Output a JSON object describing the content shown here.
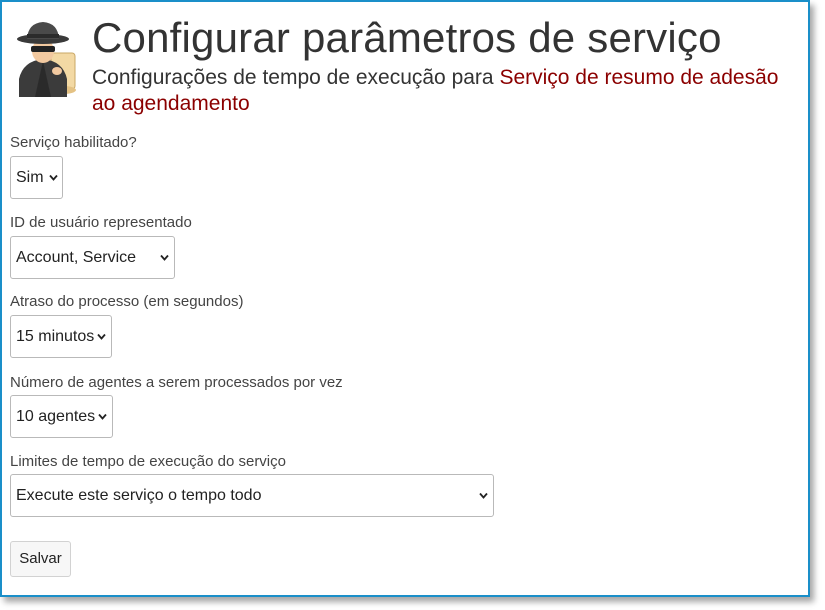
{
  "header": {
    "title": "Configurar parâmetros de serviço",
    "subtitle_prefix": "Configurações de tempo de execução para ",
    "service_name": "Serviço de resumo de adesão ao agendamento",
    "service_color": "#8b0000",
    "logo_icon": "spy-agent-icon"
  },
  "fields": {
    "enabled": {
      "label": "Serviço habilitado?",
      "value": "Sim"
    },
    "impersonated_user": {
      "label": "ID de usuário representado",
      "value": "Account, Service"
    },
    "process_delay": {
      "label": "Atraso do processo (em segundos)",
      "value": "15 minutos"
    },
    "agents_per_batch": {
      "label": "Número de agentes a serem processados por vez",
      "value": "10 agentes"
    },
    "runtime_limits": {
      "label": "Limites de tempo de execução do serviço",
      "value": "Execute este serviço o tempo todo"
    }
  },
  "actions": {
    "save_label": "Salvar"
  },
  "colors": {
    "frame_border": "#1a8fc9",
    "text": "#333333"
  }
}
